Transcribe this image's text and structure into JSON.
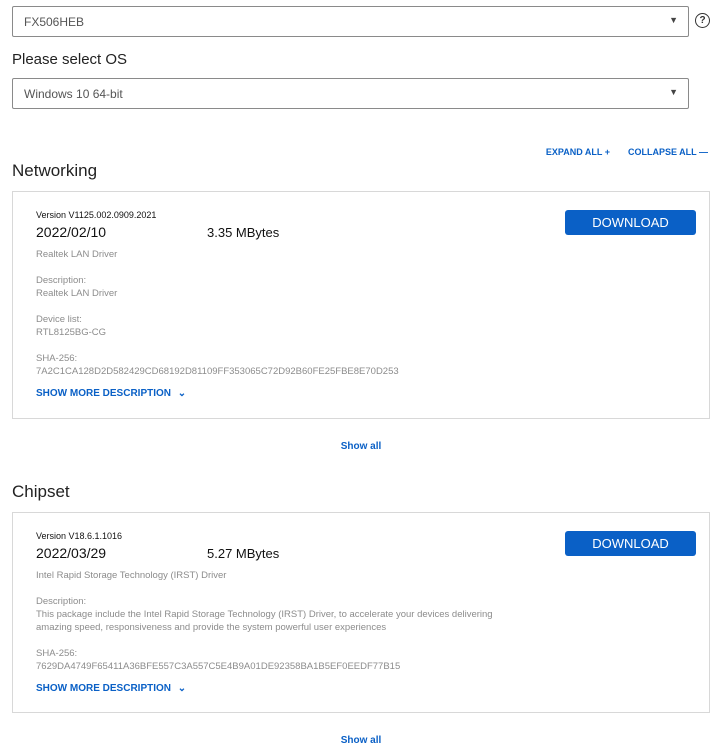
{
  "model_select": {
    "value": "FX506HEB"
  },
  "help": {
    "glyph": "?"
  },
  "os_label": "Please select OS",
  "os_select": {
    "value": "Windows 10 64-bit"
  },
  "toolbar": {
    "expand_all": "EXPAND ALL  +",
    "collapse_all": "COLLAPSE ALL  —"
  },
  "sections": [
    {
      "title": "Networking",
      "item": {
        "version": "Version V1125.002.0909.2021",
        "date": "2022/02/10",
        "size": "3.35 MBytes",
        "name": "Realtek LAN Driver",
        "description_label": "Description:",
        "description": "Realtek LAN Driver",
        "device_list_label": "Device list:",
        "device_list": "RTL8125BG-CG",
        "sha_label": "SHA-256:",
        "sha": "7A2C1CA128D2D582429CD68192D81109FF353065C72D92B60FE25FBE8E70D253",
        "download": "DOWNLOAD",
        "show_more": "SHOW MORE DESCRIPTION"
      },
      "show_all": "Show all"
    },
    {
      "title": "Chipset",
      "item": {
        "version": "Version V18.6.1.1016",
        "date": "2022/03/29",
        "size": "5.27 MBytes",
        "name": "Intel Rapid Storage Technology (IRST) Driver",
        "description_label": "Description:",
        "description_line1": "This package include the Intel Rapid Storage Technology (IRST) Driver, to accelerate your devices delivering",
        "description_line2": "amazing speed, responsiveness and provide the system powerful user experiences",
        "sha_label": "SHA-256:",
        "sha": "7629DA4749F65411A36BFE557C3A557C5E4B9A01DE92358BA1B5EF0EEDF77B15",
        "download": "DOWNLOAD",
        "show_more": "SHOW MORE DESCRIPTION"
      },
      "show_all": "Show all"
    }
  ],
  "icons": {
    "caret": "dropdown-caret-icon",
    "chevron": "chevron-down-icon",
    "help": "help-circle-icon"
  },
  "colors": {
    "accent": "#0a60c6",
    "muted_text": "#8c8c8c",
    "border": "#d8d8d8"
  }
}
